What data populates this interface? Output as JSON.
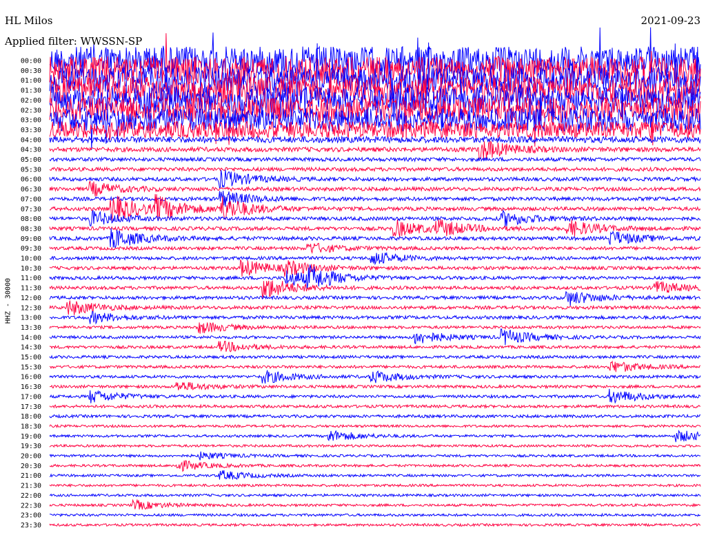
{
  "header": {
    "station": "HL Milos",
    "date": "2021-09-23",
    "filter": "Applied filter: WWSSN-SP"
  },
  "chart_data": {
    "type": "line",
    "title": "HL Milos",
    "ylabel": "HHZ - 30000",
    "date": "2021-09-23",
    "filter": "WWSSN-SP",
    "row_labels": [
      "00:00",
      "00:30",
      "01:00",
      "01:30",
      "02:00",
      "02:30",
      "03:00",
      "03:30",
      "04:00",
      "04:30",
      "05:00",
      "05:30",
      "06:00",
      "06:30",
      "07:00",
      "07:30",
      "08:00",
      "08:30",
      "09:00",
      "09:30",
      "10:00",
      "10:30",
      "11:00",
      "11:30",
      "12:00",
      "12:30",
      "13:00",
      "13:30",
      "14:00",
      "14:30",
      "15:00",
      "15:30",
      "16:00",
      "16:30",
      "17:00",
      "17:30",
      "18:00",
      "18:30",
      "19:00",
      "19:30",
      "20:00",
      "20:30",
      "21:00",
      "21:30",
      "22:00",
      "22:30",
      "23:00",
      "23:30"
    ],
    "series_colors": [
      "#0000ff",
      "#ff0040"
    ],
    "noise_level_per_row": [
      3.4,
      3.4,
      3.2,
      3.2,
      3.2,
      3.0,
      2.8,
      2.0,
      0.75,
      0.55,
      0.45,
      0.45,
      0.45,
      0.45,
      0.45,
      0.45,
      0.45,
      0.45,
      0.45,
      0.4,
      0.4,
      0.4,
      0.4,
      0.4,
      0.4,
      0.4,
      0.4,
      0.35,
      0.35,
      0.35,
      0.35,
      0.35,
      0.35,
      0.35,
      0.35,
      0.35,
      0.35,
      0.3,
      0.3,
      0.3,
      0.3,
      0.3,
      0.3,
      0.3,
      0.3,
      0.3,
      0.3,
      0.3
    ],
    "events": [
      {
        "row": 9,
        "minute": 20,
        "amp": 2.2
      },
      {
        "row": 12,
        "minute": 8,
        "amp": 2.0
      },
      {
        "row": 13,
        "minute": 2,
        "amp": 1.5
      },
      {
        "row": 14,
        "minute": 8,
        "amp": 1.8
      },
      {
        "row": 15,
        "minute": 3,
        "amp": 3.0
      },
      {
        "row": 15,
        "minute": 5,
        "amp": 2.5
      },
      {
        "row": 15,
        "minute": 8,
        "amp": 2.6
      },
      {
        "row": 16,
        "minute": 2,
        "amp": 1.6
      },
      {
        "row": 16,
        "minute": 21,
        "amp": 1.6
      },
      {
        "row": 17,
        "minute": 16,
        "amp": 1.8
      },
      {
        "row": 17,
        "minute": 18,
        "amp": 1.6
      },
      {
        "row": 17,
        "minute": 24,
        "amp": 1.8
      },
      {
        "row": 18,
        "minute": 3,
        "amp": 2.2
      },
      {
        "row": 18,
        "minute": 26,
        "amp": 1.5
      },
      {
        "row": 19,
        "minute": 12,
        "amp": 1.2
      },
      {
        "row": 20,
        "minute": 15,
        "amp": 1.4
      },
      {
        "row": 21,
        "minute": 9,
        "amp": 1.8
      },
      {
        "row": 21,
        "minute": 11,
        "amp": 1.4
      },
      {
        "row": 22,
        "minute": 11,
        "amp": 1.8
      },
      {
        "row": 22,
        "minute": 12,
        "amp": 2.2
      },
      {
        "row": 23,
        "minute": 10,
        "amp": 2.4
      },
      {
        "row": 23,
        "minute": 28,
        "amp": 1.4
      },
      {
        "row": 24,
        "minute": 24,
        "amp": 1.6
      },
      {
        "row": 25,
        "minute": 1,
        "amp": 1.6
      },
      {
        "row": 26,
        "minute": 2,
        "amp": 1.2
      },
      {
        "row": 27,
        "minute": 7,
        "amp": 1.3
      },
      {
        "row": 28,
        "minute": 17,
        "amp": 1.5
      },
      {
        "row": 28,
        "minute": 21,
        "amp": 1.7
      },
      {
        "row": 29,
        "minute": 8,
        "amp": 1.2
      },
      {
        "row": 31,
        "minute": 26,
        "amp": 1.3
      },
      {
        "row": 32,
        "minute": 10,
        "amp": 1.4
      },
      {
        "row": 32,
        "minute": 15,
        "amp": 1.3
      },
      {
        "row": 33,
        "minute": 6,
        "amp": 1.1
      },
      {
        "row": 34,
        "minute": 2,
        "amp": 1.4
      },
      {
        "row": 34,
        "minute": 26,
        "amp": 1.5
      },
      {
        "row": 38,
        "minute": 13,
        "amp": 1.3
      },
      {
        "row": 38,
        "minute": 29,
        "amp": 1.3
      },
      {
        "row": 40,
        "minute": 7,
        "amp": 0.8
      },
      {
        "row": 41,
        "minute": 6,
        "amp": 1.2
      },
      {
        "row": 42,
        "minute": 8,
        "amp": 1.0
      },
      {
        "row": 45,
        "minute": 4,
        "amp": 1.0
      }
    ]
  }
}
